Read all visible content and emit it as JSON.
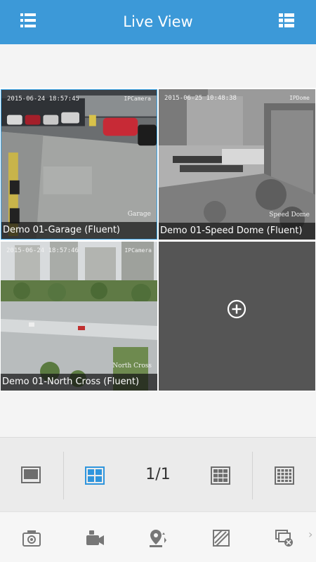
{
  "header": {
    "title": "Live View",
    "left_icon": "menu-icon",
    "right_icon": "list-view-icon"
  },
  "cameras": [
    {
      "caption": "Demo 01-Garage (Fluent)",
      "osd_time": "2015-06-24 18:57:45",
      "osd_camera": "IPCamera",
      "osd_location": "Garage"
    },
    {
      "caption": "Demo 01-Speed Dome (Fluent)",
      "osd_time": "2015-06-25 10:48:38",
      "osd_camera": "IPDome",
      "osd_location": "Speed Dome"
    },
    {
      "caption": "Demo 01-North Cross (Fluent)",
      "osd_time": "2015-06-24 18:57:46",
      "osd_camera": "IPCamera",
      "osd_location": "North Cross"
    }
  ],
  "empty_slot": {
    "icon": "add-camera-icon"
  },
  "layout_bar": {
    "page_indicator": "1/1",
    "options": [
      "single-view-icon",
      "quad-view-icon",
      "nine-view-icon",
      "sixteen-view-icon"
    ],
    "selected": "quad-view-icon"
  },
  "toolbar": {
    "tools": [
      "capture-icon",
      "record-icon",
      "ptz-icon",
      "image-quality-icon",
      "stop-all-icon"
    ],
    "more": "›"
  },
  "colors": {
    "accent": "#3c99d8",
    "selected_border": "#37a3e6"
  }
}
